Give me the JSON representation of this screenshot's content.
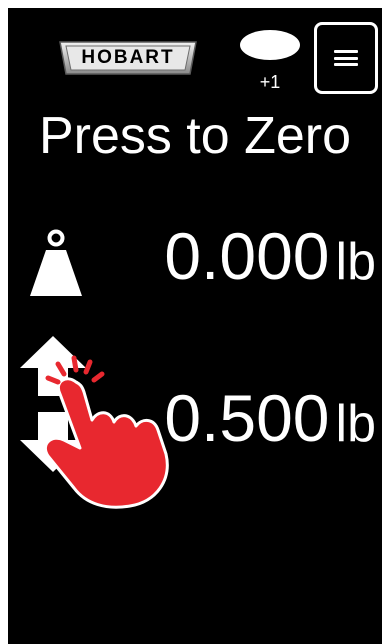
{
  "header": {
    "brand": "HOBART",
    "notification_count": "+1",
    "menu_icon": "hamburger-menu-icon"
  },
  "main": {
    "title": "Press to Zero",
    "gross_weight": {
      "icon": "weight-icon",
      "value": "0.000",
      "unit": "lb"
    },
    "tare_weight": {
      "icon": "tare-arrows-icon",
      "value": "0.500",
      "unit": "lb"
    }
  },
  "overlay": {
    "icon": "tapping-hand-icon"
  },
  "colors": {
    "background": "#000000",
    "foreground": "#ffffff",
    "hand_red": "#e8282f"
  }
}
